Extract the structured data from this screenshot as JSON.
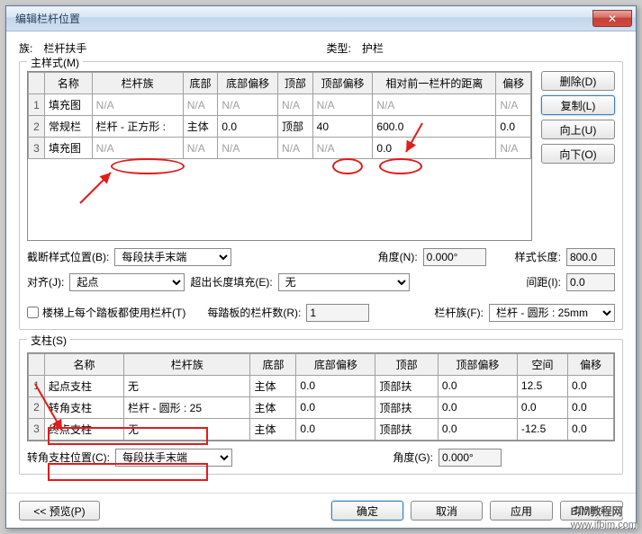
{
  "title": "编辑栏杆位置",
  "header": {
    "family_lbl": "族:",
    "family_val": "栏杆扶手",
    "type_lbl": "类型:",
    "type_val": "护栏"
  },
  "main": {
    "group_title": "主样式(M)",
    "cols": [
      "",
      "名称",
      "栏杆族",
      "底部",
      "底部偏移",
      "顶部",
      "顶部偏移",
      "相对前一栏杆的距离",
      "偏移"
    ],
    "rows": [
      {
        "n": "1",
        "vals": [
          "填充图",
          "N/A",
          "N/A",
          "N/A",
          "N/A",
          "N/A",
          "N/A",
          "N/A"
        ],
        "gray": true
      },
      {
        "n": "2",
        "vals": [
          "常规栏",
          "栏杆 - 正方形 :",
          "主体",
          "0.0",
          "顶部",
          "40",
          "600.0",
          "0.0"
        ],
        "gray": false
      },
      {
        "n": "3",
        "vals": [
          "填充图",
          "N/A",
          "N/A",
          "N/A",
          "N/A",
          "N/A",
          "0.0",
          "N/A"
        ],
        "gray": true
      }
    ],
    "buttons": {
      "delete": "删除(D)",
      "copy": "复制(L)",
      "up": "向上(U)",
      "down": "向下(O)"
    },
    "break_lbl": "截断样式位置(B):",
    "break_val": "每段扶手末端",
    "angle_lbl": "角度(N):",
    "angle_val": "0.000°",
    "len_lbl": "样式长度:",
    "len_val": "800.0",
    "align_lbl": "对齐(J):",
    "align_val": "起点",
    "over_lbl": "超出长度填充(E):",
    "over_val": "无",
    "spacing_lbl": "间距(I):",
    "spacing_val": "0.0",
    "stair_chk": "楼梯上每个踏板都使用栏杆(T)",
    "pertread_lbl": "每踏板的栏杆数(R):",
    "pertread_val": "1",
    "balfam_lbl": "栏杆族(F):",
    "balfam_val": "栏杆 - 圆形 : 25mm"
  },
  "post": {
    "group_title": "支柱(S)",
    "cols": [
      "",
      "名称",
      "栏杆族",
      "底部",
      "底部偏移",
      "顶部",
      "顶部偏移",
      "空间",
      "偏移"
    ],
    "rows": [
      {
        "n": "1",
        "vals": [
          "起点支柱",
          "无",
          "主体",
          "0.0",
          "顶部扶",
          "0.0",
          "12.5",
          "0.0"
        ]
      },
      {
        "n": "2",
        "vals": [
          "转角支柱",
          "栏杆 - 圆形 : 25",
          "主体",
          "0.0",
          "顶部扶",
          "0.0",
          "0.0",
          "0.0"
        ]
      },
      {
        "n": "3",
        "vals": [
          "终点支柱",
          "无",
          "主体",
          "0.0",
          "顶部扶",
          "0.0",
          "-12.5",
          "0.0"
        ]
      }
    ],
    "corner_lbl": "转角支柱位置(C):",
    "corner_val": "每段扶手末端",
    "cangle_lbl": "角度(G):",
    "cangle_val": "0.000°"
  },
  "footer": {
    "preview": "<< 预览(P)",
    "ok": "确定",
    "cancel": "取消",
    "apply": "应用",
    "help": "帮助(H)"
  },
  "watermark": {
    "big": "BIM教程网",
    "small": "www.ifbim.com"
  }
}
